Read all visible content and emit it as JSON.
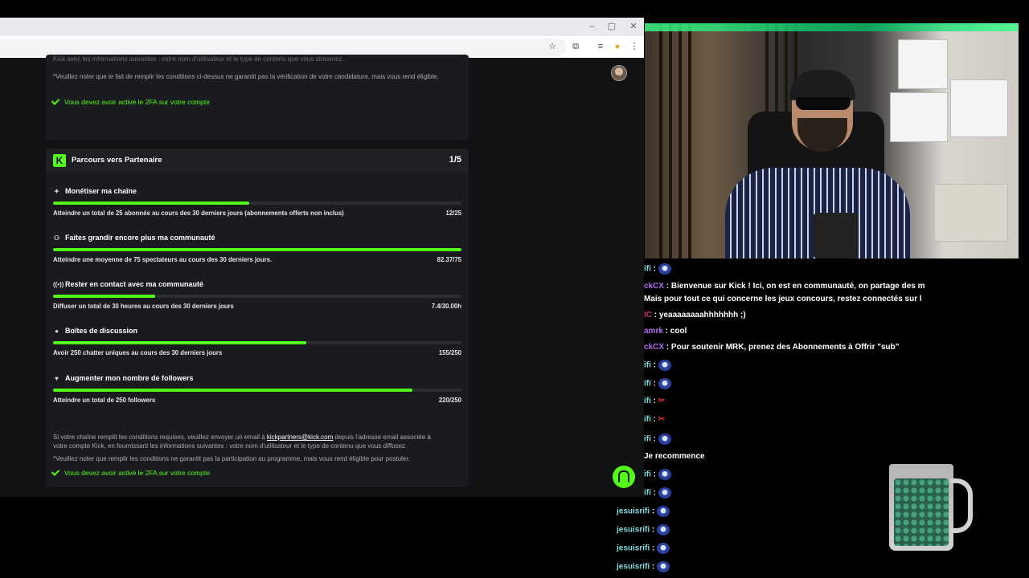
{
  "browser": {
    "window_controls": [
      "–",
      "▢",
      "✕"
    ],
    "toolbar_icons": [
      "star-icon",
      "extensions-icon",
      "media-icon",
      "profile-icon",
      "menu-icon"
    ]
  },
  "card_top": {
    "line1": "Kick avec les informations suivantes : votre nom d'utilisateur et le type de contenu que vous streamez.",
    "line2": "*Veuillez noter que le fait de remplir les conditions ci-dessus ne garantit pas la vérification de votre candidature, mais vous rend éligible.",
    "check": "Vous devez avoir activé le 2FA sur votre compte"
  },
  "partner": {
    "logo": "K",
    "title": "Parcours vers Partenaire",
    "step": "1/5",
    "sections": [
      {
        "title": "Monétiser ma chaîne",
        "icon": "✦",
        "desc": "Atteindre un total de 25 abonnés au cours des 30 derniers jours (abonnements offerts non inclus)",
        "value": "12/25",
        "progress": 0.48
      },
      {
        "title": "Faites grandir encore plus ma communauté",
        "icon": "⚇",
        "desc": "Atteindre une moyenne de 75 spectateurs au cours des 30 derniers jours.",
        "value": "82.37/75",
        "progress": 1.0
      },
      {
        "title": "Rester en contact avec ma communauté",
        "icon": "((•))",
        "desc": "Diffuser un total de 30 heures au cours des 30 derniers jours",
        "value": "7.4/30.00h",
        "progress": 0.25
      },
      {
        "title": "Boîtes de discussion",
        "icon": "●",
        "desc": "Avoir 250 chatter uniques au cours des 30 derniers jours",
        "value": "155/250",
        "progress": 0.62
      },
      {
        "title": "Augmenter mon nombre de followers",
        "icon": "♥",
        "desc": "Atteindre un total de 250 followers",
        "value": "220/250",
        "progress": 0.88
      }
    ],
    "footer_before_link": "Si votre chaîne remplit les conditions requises, veuillez envoyer un email à ",
    "footer_link": "kickpartners@kick.com",
    "footer_after_link": " depuis l'adresse email associée à",
    "footer_line2": "votre compte Kick, en fournissant les informations suivantes : votre nom d'utilisateur et le type de contenu que vous diffusez.",
    "footer_note": "*Veuillez noter que remplir les conditions ne garantit pas la participation au programme, mais vous rend éligible pour postuler.",
    "footer_check": "Vous devez avoir activé le 2FA sur votre compte"
  },
  "chat": {
    "messages": [
      {
        "user": "ifi",
        "sep": " : ",
        "text": "",
        "emote": "emote",
        "color": "#7fdce0"
      },
      {
        "user": "ckCX",
        "sep": " : ",
        "text": "Bienvenue sur Kick ! Ici, on est en communauté, on partage des m",
        "emote": "",
        "color": "#b06cf0"
      },
      {
        "user": "",
        "sep": "",
        "text": "Mais pour tout ce qui concerne les jeux concours, restez connectés sur l",
        "emote": "",
        "color": "#ffffff"
      },
      {
        "user": "IC",
        "sep": " : ",
        "text": "yeaaaaaaaahhhhhhh ;)",
        "emote": "",
        "color": "#d2345a"
      },
      {
        "user": "amrk",
        "sep": " : ",
        "text": "cool",
        "emote": "",
        "color": "#b06cf0"
      },
      {
        "user": "ckCX",
        "sep": " : ",
        "text": "Pour soutenir MRK, prenez des Abonnements à Offrir \"sub\"",
        "emote": "",
        "color": "#b06cf0"
      },
      {
        "user": "ifi",
        "sep": " : ",
        "text": "",
        "emote": "emote",
        "color": "#7fdce0"
      },
      {
        "user": "ifi",
        "sep": " : ",
        "text": "",
        "emote": "emote",
        "color": "#7fdce0"
      },
      {
        "user": "ifi",
        "sep": " : ",
        "text": "",
        "emote": "red",
        "color": "#7fdce0"
      },
      {
        "user": "ifi",
        "sep": " : ",
        "text": "",
        "emote": "red",
        "color": "#7fdce0"
      },
      {
        "user": "ifi",
        "sep": " : ",
        "text": "",
        "emote": "emote",
        "color": "#7fdce0"
      },
      {
        "user": "",
        "sep": "",
        "text": "Je recommence",
        "emote": "",
        "color": "#ffffff"
      },
      {
        "user": "ifi",
        "sep": " : ",
        "text": "",
        "emote": "emote",
        "color": "#7fdce0"
      },
      {
        "user": "ifi",
        "sep": " : ",
        "text": "",
        "emote": "emote",
        "color": "#7fdce0"
      },
      {
        "user": "jesuisrifi",
        "sep": " : ",
        "text": "",
        "emote": "emote",
        "color": "#7fdce0"
      },
      {
        "user": "jesuisrifi",
        "sep": " : ",
        "text": "",
        "emote": "emote",
        "color": "#7fdce0"
      },
      {
        "user": "jesuisrifi",
        "sep": " : ",
        "text": "",
        "emote": "emote",
        "color": "#7fdce0"
      },
      {
        "user": "jesuisrifi",
        "sep": " : ",
        "text": "",
        "emote": "emote",
        "color": "#7fdce0"
      }
    ]
  },
  "colors": {
    "accent": "#53fc18",
    "page_bg": "#111214",
    "card_bg": "#1a1b1e"
  }
}
